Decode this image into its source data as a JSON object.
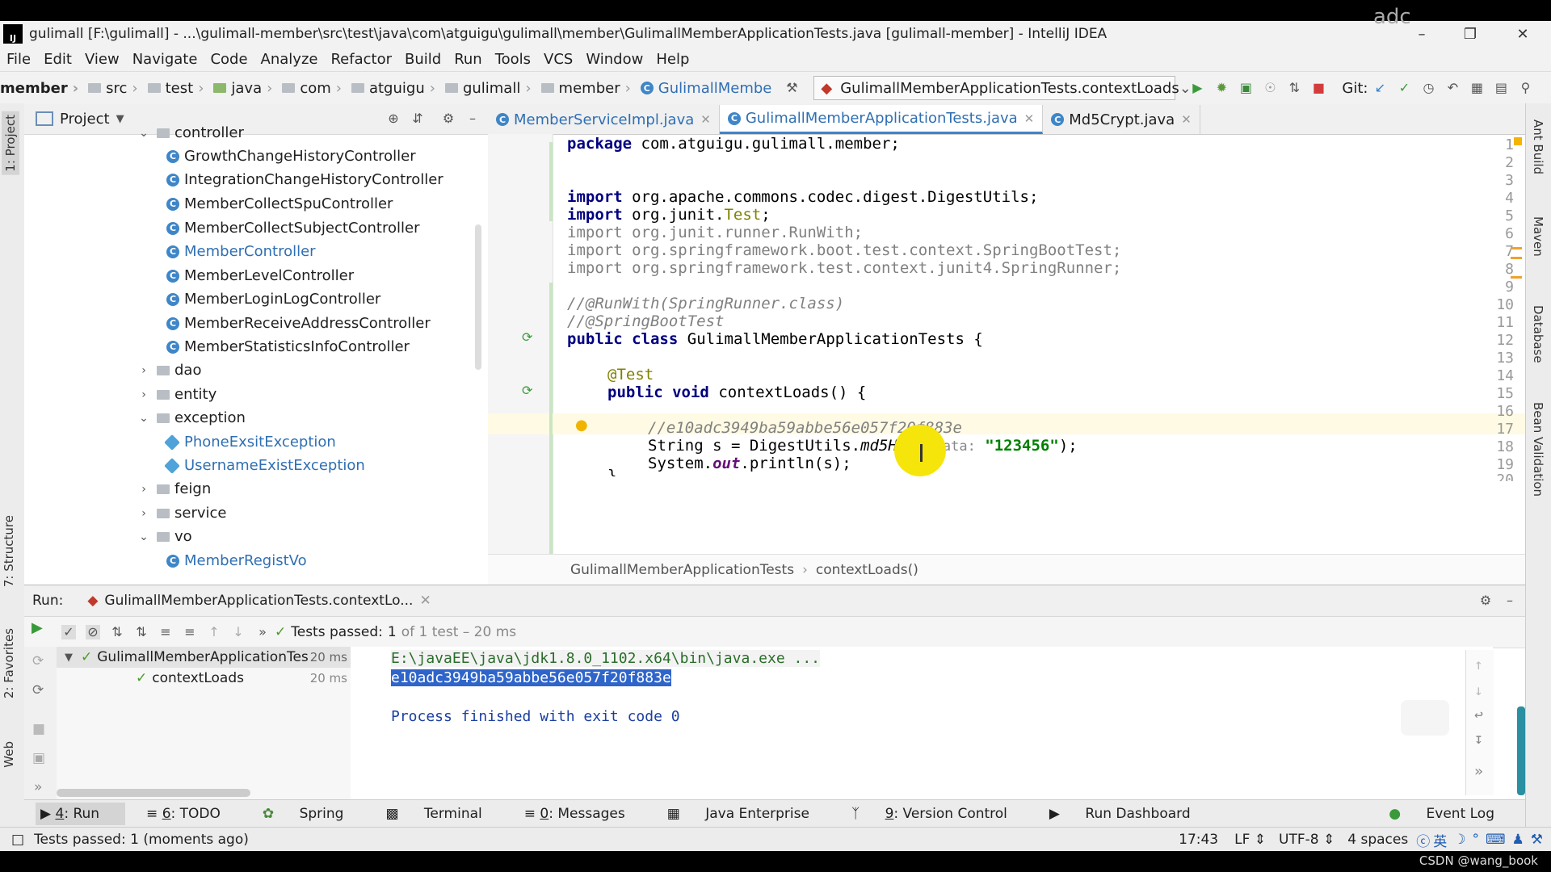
{
  "window": {
    "title": "gulimall [F:\\gulimall] - ...\\gulimall-member\\src\\test\\java\\com\\atguigu\\gulimall\\member\\GulimallMemberApplicationTests.java [gulimall-member] - IntelliJ IDEA",
    "overlay_text": "adc"
  },
  "menu": [
    "File",
    "Edit",
    "View",
    "Navigate",
    "Code",
    "Analyze",
    "Refactor",
    "Build",
    "Run",
    "Tools",
    "VCS",
    "Window",
    "Help"
  ],
  "breadcrumb": [
    "member",
    "src",
    "test",
    "java",
    "com",
    "atguigu",
    "gulimall",
    "member",
    "GulimallMembe"
  ],
  "run_config": "GulimallMemberApplicationTests.contextLoads",
  "git_label": "Git:",
  "project_panel": {
    "title": "Project",
    "tree": [
      {
        "label": "controller",
        "type": "folder",
        "expanded": true
      },
      {
        "label": "GrowthChangeHistoryController",
        "type": "class"
      },
      {
        "label": "IntegrationChangeHistoryController",
        "type": "class"
      },
      {
        "label": "MemberCollectSpuController",
        "type": "class"
      },
      {
        "label": "MemberCollectSubjectController",
        "type": "class"
      },
      {
        "label": "MemberController",
        "type": "class",
        "highlight": true
      },
      {
        "label": "MemberLevelController",
        "type": "class"
      },
      {
        "label": "MemberLoginLogController",
        "type": "class"
      },
      {
        "label": "MemberReceiveAddressController",
        "type": "class"
      },
      {
        "label": "MemberStatisticsInfoController",
        "type": "class"
      },
      {
        "label": "dao",
        "type": "folder",
        "expanded": false
      },
      {
        "label": "entity",
        "type": "folder",
        "expanded": false
      },
      {
        "label": "exception",
        "type": "folder",
        "expanded": true
      },
      {
        "label": "PhoneExsitException",
        "type": "exception"
      },
      {
        "label": "UsernameExistException",
        "type": "exception"
      },
      {
        "label": "feign",
        "type": "folder",
        "expanded": false
      },
      {
        "label": "service",
        "type": "folder",
        "expanded": false
      },
      {
        "label": "vo",
        "type": "folder",
        "expanded": true
      },
      {
        "label": "MemberRegistVo",
        "type": "class",
        "highlight": true
      }
    ]
  },
  "editor_tabs": [
    {
      "label": "MemberServiceImpl.java",
      "active": false
    },
    {
      "label": "GulimallMemberApplicationTests.java",
      "active": true
    },
    {
      "label": "Md5Crypt.java",
      "active": false
    }
  ],
  "code": {
    "line1_pkg": "com.atguigu.gulimall.member;",
    "line4": "org.apache.commons.codec.digest.DigestUtils;",
    "line5_pkg": "org.junit.",
    "line5_cls": "Test",
    "line6": "org.junit.runner.RunWith;",
    "line7": "org.springframework.boot.test.context.SpringBootTest;",
    "line8": "org.springframework.test.context.junit4.SpringRunner;",
    "line10": "//@RunWith(SpringRunner.class)",
    "line11": "//@SpringBootTest",
    "line12_name": "GulimallMemberApplicationTests {",
    "line14": "@Test",
    "line15_name": "contextLoads() {",
    "line17": "//e10adc3949ba59abbe56e057f20f883e",
    "line18_a": "String s = DigestUtils.",
    "line18_m": "md5Hex",
    "line18_h": "data:",
    "line18_s": "\"123456\"",
    "line19_a": "System.",
    "line19_f": "out",
    "line19_b": ".println(s);",
    "kw_package": "package",
    "kw_import": "import",
    "kw_public": "public",
    "kw_class": "class",
    "kw_void": "void",
    "p_open": "(",
    "p_close": ");",
    "line20": "}"
  },
  "editor_breadcrumb": [
    "GulimallMemberApplicationTests",
    "contextLoads()"
  ],
  "run_panel": {
    "label": "Run:",
    "tab": "GulimallMemberApplicationTests.contextLo...",
    "tests_passed": "Tests passed:",
    "tests_count": "1",
    "tests_of": "of 1 test – 20 ms",
    "tree": [
      {
        "label": "GulimallMemberApplicationTes",
        "time": "20 ms"
      },
      {
        "label": "contextLoads",
        "time": "20 ms"
      }
    ],
    "console": [
      "E:\\javaEE\\java\\jdk1.8.0_1102.x64\\bin\\java.exe ...",
      "e10adc3949ba59abbe56e057f20f883e",
      "Process finished with exit code 0"
    ]
  },
  "bottom_tabs": [
    {
      "num": "4",
      "label": ": Run"
    },
    {
      "num": "6",
      "label": ": TODO"
    },
    {
      "num": "",
      "label": "Spring"
    },
    {
      "num": "",
      "label": "Terminal"
    },
    {
      "num": "0",
      "label": ": Messages"
    },
    {
      "num": "",
      "label": "Java Enterprise"
    },
    {
      "num": "9",
      "label": ": Version Control"
    },
    {
      "num": "",
      "label": "Run Dashboard"
    }
  ],
  "event_log": "Event Log",
  "status": {
    "message": "Tests passed: 1 (moments ago)",
    "position": "17:43",
    "line_sep": "LF",
    "encoding": "UTF-8",
    "indent": "4 spaces",
    "ime": "英"
  },
  "side_tabs_left": [
    "1: Project",
    "7: Structure",
    "2: Favorites",
    "Web"
  ],
  "side_tabs_right": [
    "Ant Build",
    "Maven",
    "Database",
    "Bean Validation"
  ],
  "watermark": "CSDN @wang_book"
}
